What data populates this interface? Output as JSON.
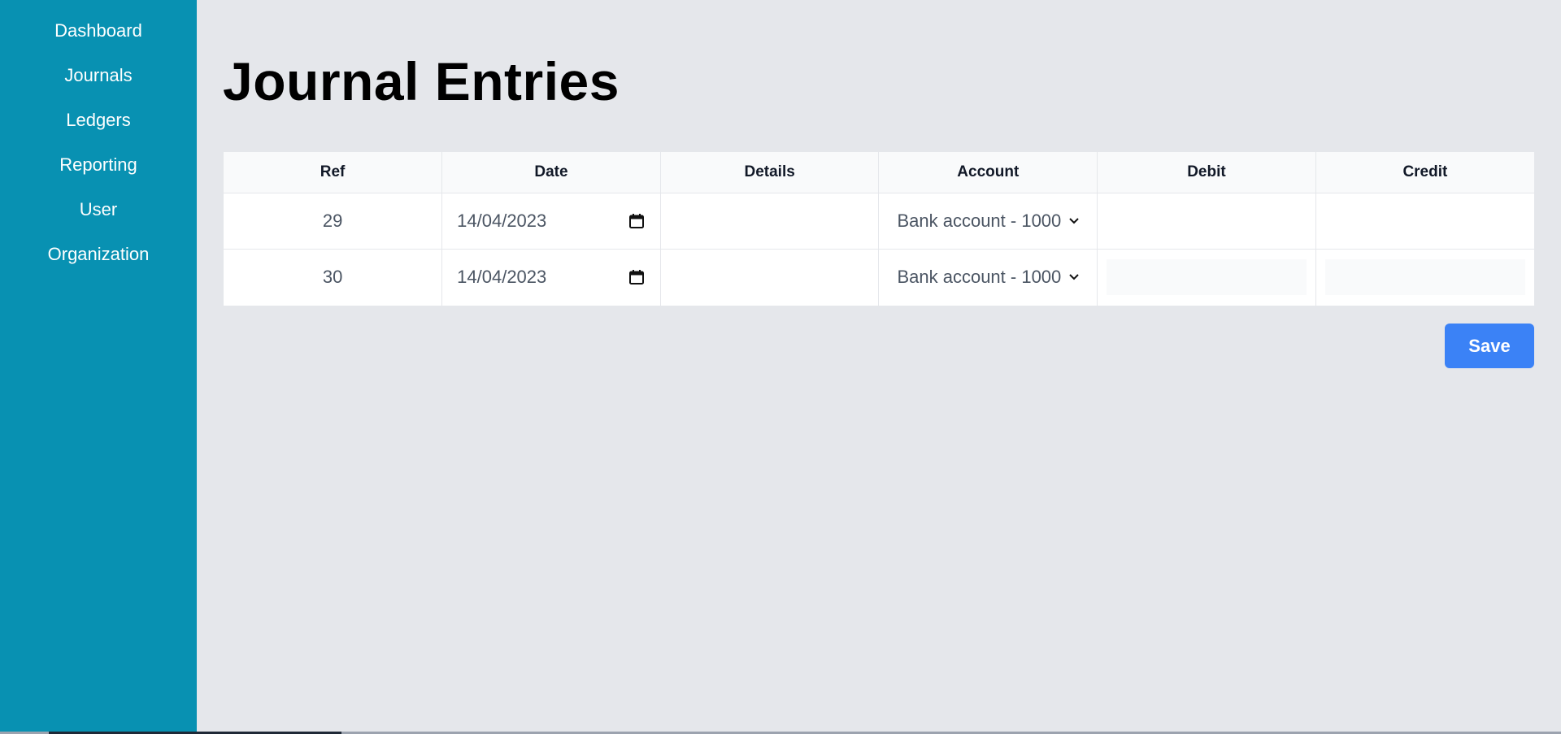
{
  "sidebar": {
    "items": [
      {
        "label": "Dashboard"
      },
      {
        "label": "Journals"
      },
      {
        "label": "Ledgers"
      },
      {
        "label": "Reporting"
      },
      {
        "label": "User"
      },
      {
        "label": "Organization"
      }
    ]
  },
  "main": {
    "title": "Journal Entries",
    "table": {
      "headers": [
        "Ref",
        "Date",
        "Details",
        "Account",
        "Debit",
        "Credit"
      ],
      "rows": [
        {
          "ref": "29",
          "date": "14/04/2023",
          "details": "",
          "account": "Bank account - 1000",
          "debit": "",
          "credit": ""
        },
        {
          "ref": "30",
          "date": "14/04/2023",
          "details": "",
          "account": "Bank account - 1000",
          "debit": "",
          "credit": ""
        }
      ]
    },
    "save_label": "Save"
  },
  "colors": {
    "sidebar_bg": "#0891b2",
    "page_bg": "#e5e7eb",
    "button_bg": "#3b82f6"
  },
  "icons": {
    "date_picker": "calendar-icon",
    "select_arrow": "chevron-down-icon"
  }
}
